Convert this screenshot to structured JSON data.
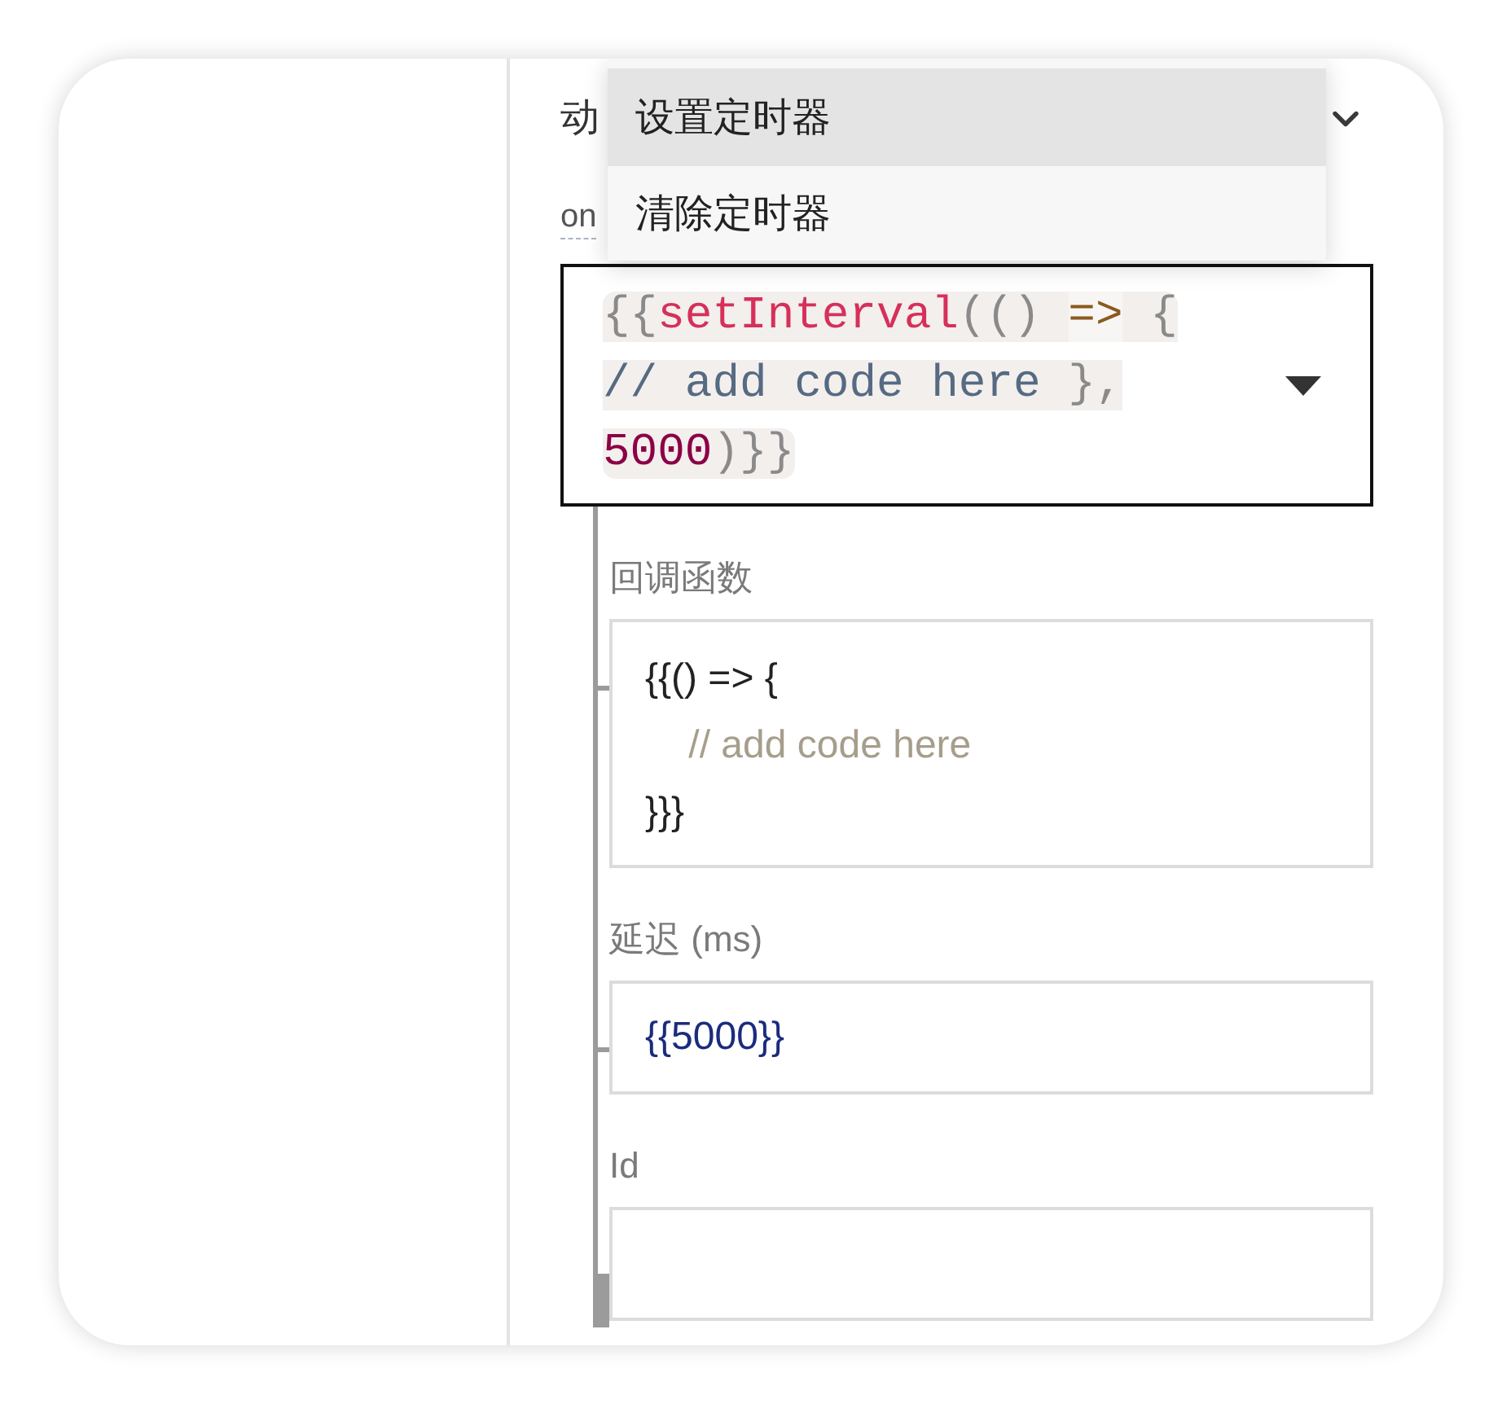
{
  "section_heading": "动",
  "event_label": "on",
  "dropdown_menu": {
    "items": [
      {
        "label": "设置定时器",
        "selected": true
      },
      {
        "label": "清除定时器",
        "selected": false
      }
    ]
  },
  "action_field": {
    "focused": true,
    "lines": [
      [
        {
          "kind": "punct",
          "text": "{{"
        },
        {
          "kind": "function",
          "text": "setInterval"
        },
        {
          "kind": "punct",
          "text": "(() "
        },
        {
          "kind": "operator",
          "text": "=>"
        },
        {
          "kind": "punct",
          "text": " {"
        }
      ],
      [
        {
          "kind": "comment",
          "text": "// add code here"
        },
        {
          "kind": "punct",
          "text": " },"
        }
      ],
      [
        {
          "kind": "number",
          "text": "5000"
        },
        {
          "kind": "punct",
          "text": ")}}"
        }
      ]
    ]
  },
  "params": [
    {
      "kind": "code",
      "label": "回调函数",
      "lines": [
        {
          "kind": "plain",
          "text": "{{() => {"
        },
        {
          "kind": "comment",
          "text": "    // add code here"
        },
        {
          "kind": "plain",
          "text": "}}}"
        }
      ]
    },
    {
      "kind": "value",
      "label": "延迟 (ms)",
      "value": "{{5000}}"
    },
    {
      "kind": "value",
      "label": "Id"
    }
  ]
}
